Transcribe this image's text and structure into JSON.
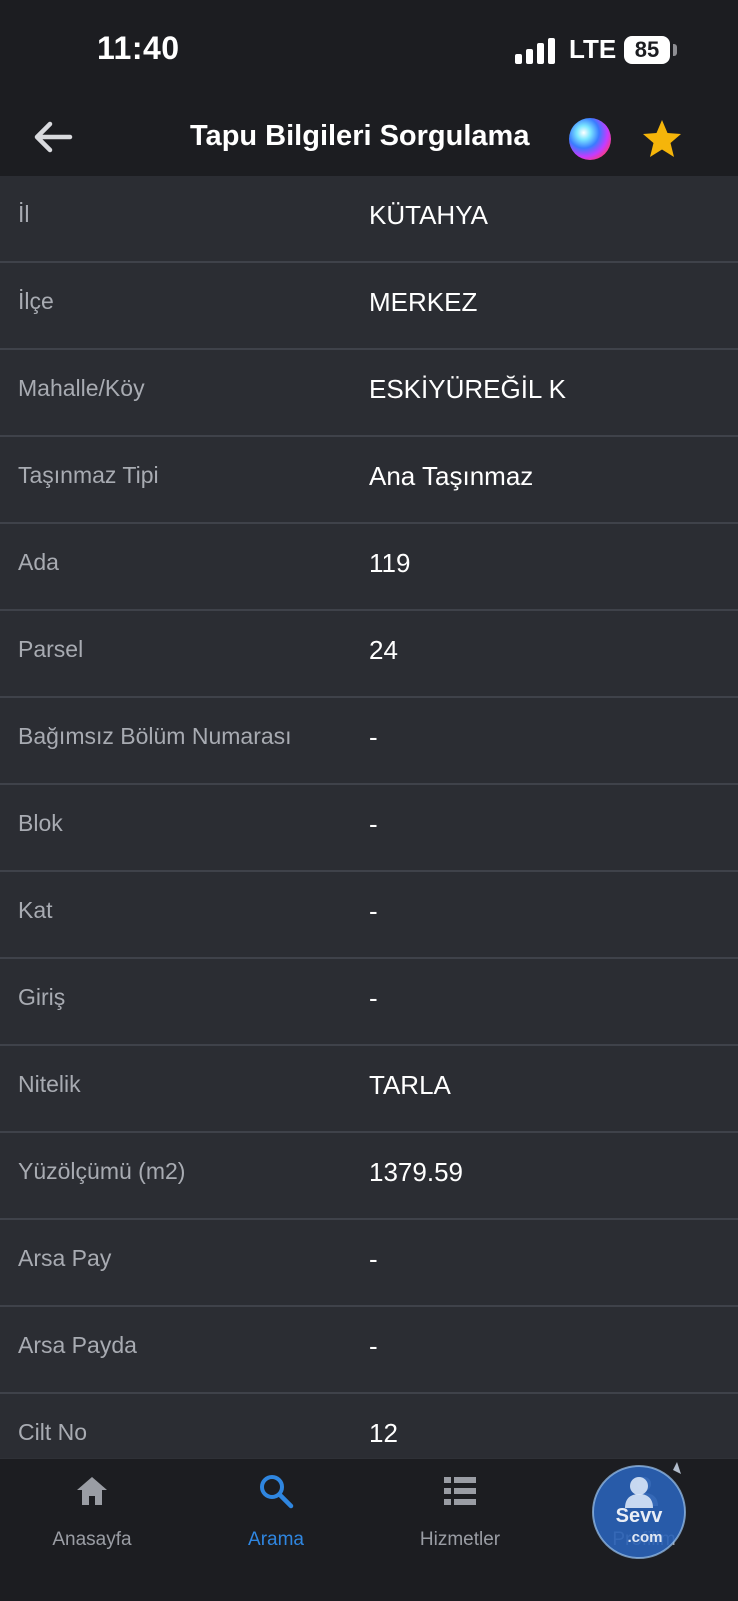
{
  "status": {
    "time": "11:40",
    "network": "LTE",
    "battery": "85"
  },
  "header": {
    "title": "Tapu Bilgileri Sorgulama",
    "back_icon": "arrow-left-icon",
    "siri_icon": "siri-icon",
    "favorite_icon": "star-icon",
    "accent": "#f5b50a"
  },
  "rows": [
    {
      "label": "İl",
      "value": "KÜTAHYA"
    },
    {
      "label": "İlçe",
      "value": "MERKEZ"
    },
    {
      "label": "Mahalle/Köy",
      "value": "ESKİYÜREĞİL K"
    },
    {
      "label": "Taşınmaz Tipi",
      "value": "Ana Taşınmaz"
    },
    {
      "label": "Ada",
      "value": "119"
    },
    {
      "label": "Parsel",
      "value": "24"
    },
    {
      "label": "Bağımsız Bölüm Numarası",
      "value": "-"
    },
    {
      "label": "Blok",
      "value": "-"
    },
    {
      "label": "Kat",
      "value": "-"
    },
    {
      "label": "Giriş",
      "value": "-"
    },
    {
      "label": "Nitelik",
      "value": "TARLA"
    },
    {
      "label": "Yüzölçümü (m2)",
      "value": "1379.59"
    },
    {
      "label": "Arsa Pay",
      "value": "-"
    },
    {
      "label": "Arsa Payda",
      "value": "-"
    },
    {
      "label": "Cilt No",
      "value": "12"
    }
  ],
  "tabs": [
    {
      "label": "Anasayfa",
      "icon": "home-icon"
    },
    {
      "label": "Arama",
      "icon": "search-icon",
      "active": true
    },
    {
      "label": "Hizmetler",
      "icon": "list-icon"
    },
    {
      "label": "Profilim",
      "icon": "person-icon"
    }
  ],
  "watermark": {
    "text": "Sevv.com"
  },
  "colors": {
    "active_tab": "#2f86e0",
    "background": "#1c1d21",
    "row_background": "#2b2d33"
  }
}
